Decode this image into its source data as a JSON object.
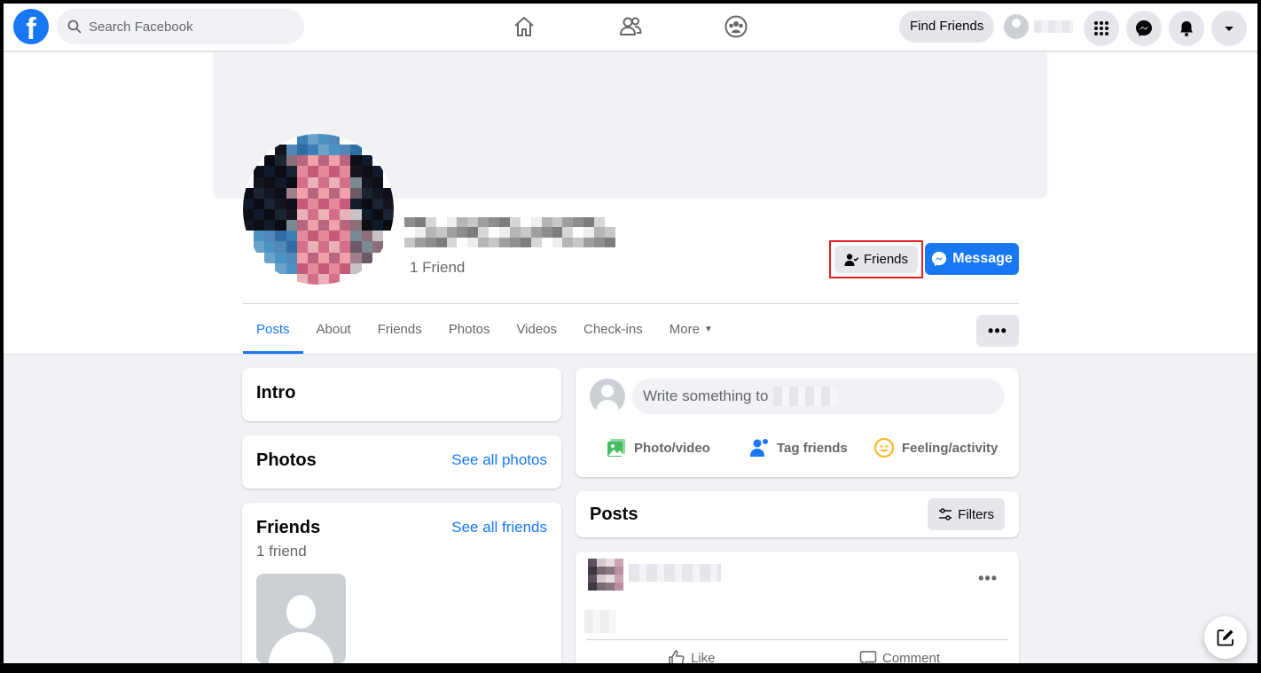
{
  "nav": {
    "search_placeholder": "Search Facebook",
    "find_friends": "Find Friends",
    "icons": [
      "home-icon",
      "friends-icon",
      "groups-icon",
      "menu-grid-icon",
      "messenger-icon",
      "notifications-icon",
      "account-caret-icon"
    ]
  },
  "profile": {
    "friend_count": "1 Friend",
    "friends_button": "Friends",
    "message_button": "Message"
  },
  "tabs": [
    {
      "label": "Posts",
      "active": true
    },
    {
      "label": "About"
    },
    {
      "label": "Friends"
    },
    {
      "label": "Photos"
    },
    {
      "label": "Videos"
    },
    {
      "label": "Check-ins"
    },
    {
      "label": "More"
    }
  ],
  "left": {
    "intro_title": "Intro",
    "photos_title": "Photos",
    "photos_link": "See all photos",
    "friends_title": "Friends",
    "friends_link": "See all friends",
    "friends_count": "1 friend"
  },
  "composer": {
    "placeholder": "Write something to",
    "actions": [
      "Photo/video",
      "Tag friends",
      "Feeling/activity"
    ]
  },
  "posts": {
    "title": "Posts",
    "filters": "Filters",
    "like": "Like",
    "comment": "Comment"
  },
  "colors": {
    "brand": "#1877f2",
    "highlight_border": "#e02020",
    "page_bg": "#f0f2f5"
  }
}
